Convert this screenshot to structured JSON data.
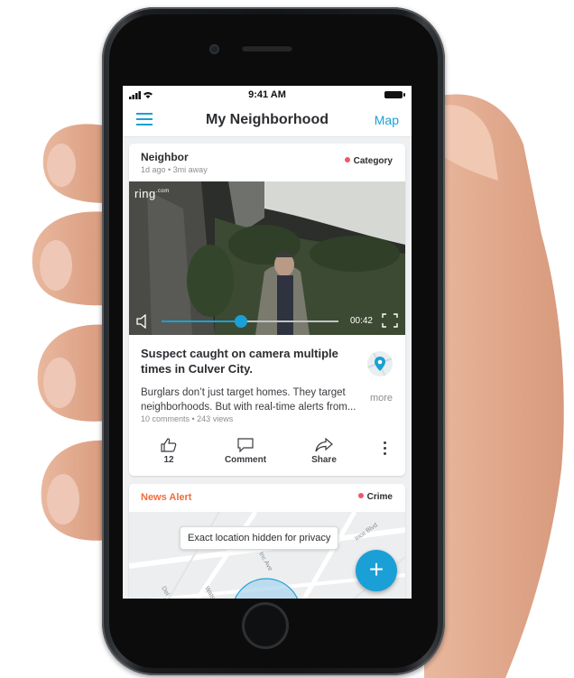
{
  "status_bar": {
    "time": "9:41 AM"
  },
  "nav": {
    "title": "My Neighborhood",
    "map_label": "Map"
  },
  "post": {
    "author": "Neighbor",
    "meta": "1d ago • 3mi away",
    "category": "Category",
    "video": {
      "brand": "ring",
      "brand_suffix": ".com",
      "duration": "00:42",
      "progress": 0.45
    },
    "headline": "Suspect caught on camera multiple times in Culver City.",
    "body": "Burglars don’t just target homes. They target\nneighborhoods. But with real-time alerts from...",
    "more_label": "more",
    "stats": "10 comments • 243 views",
    "actions": {
      "like_count": "12",
      "comment_label": "Comment",
      "share_label": "Share"
    }
  },
  "news": {
    "label": "News Alert",
    "category": "Crime",
    "map_tooltip": "Exact location hidden for privacy",
    "street_labels": [
      "Watseka Ave",
      "Inc Ave",
      "Ince Blvd",
      "Del"
    ]
  },
  "fab": {
    "label": "+"
  },
  "colors": {
    "accent": "#1aa0d6",
    "news": "#f26b3a",
    "category_dot": "#f0576b"
  }
}
